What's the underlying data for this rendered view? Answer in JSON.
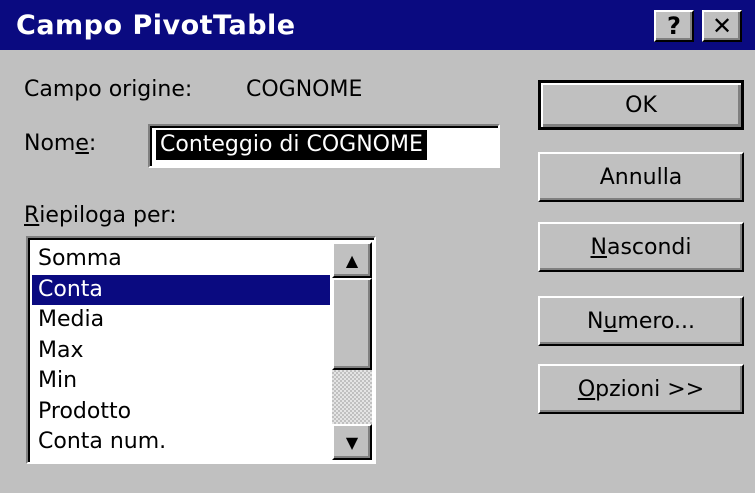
{
  "window": {
    "title": "Campo PivotTable",
    "help_button": "?",
    "close_button": "✕"
  },
  "source_field": {
    "label": "Campo origine:",
    "value": "COGNOME"
  },
  "name_field": {
    "label_pre": "Nom",
    "label_u": "e",
    "label_post": ":",
    "value": "Conteggio di COGNOME"
  },
  "summarize": {
    "label_u": "R",
    "label_rest": "iepiloga per:",
    "items": [
      "Somma",
      "Conta",
      "Media",
      "Max",
      "Min",
      "Prodotto",
      "Conta num."
    ],
    "selected": "Conta"
  },
  "scrollbar": {
    "up_icon": "▲",
    "down_icon": "▼"
  },
  "buttons": {
    "ok": "OK",
    "cancel": "Annulla",
    "hide_u": "N",
    "hide_rest": "ascondi",
    "number_pre": "N",
    "number_u": "u",
    "number_post": "mero...",
    "options_u": "O",
    "options_rest": "pzioni >>"
  },
  "colors": {
    "title_bar": "#0a0a80",
    "dialog_bg": "#c0c0c0",
    "selection": "#0a0a80"
  }
}
